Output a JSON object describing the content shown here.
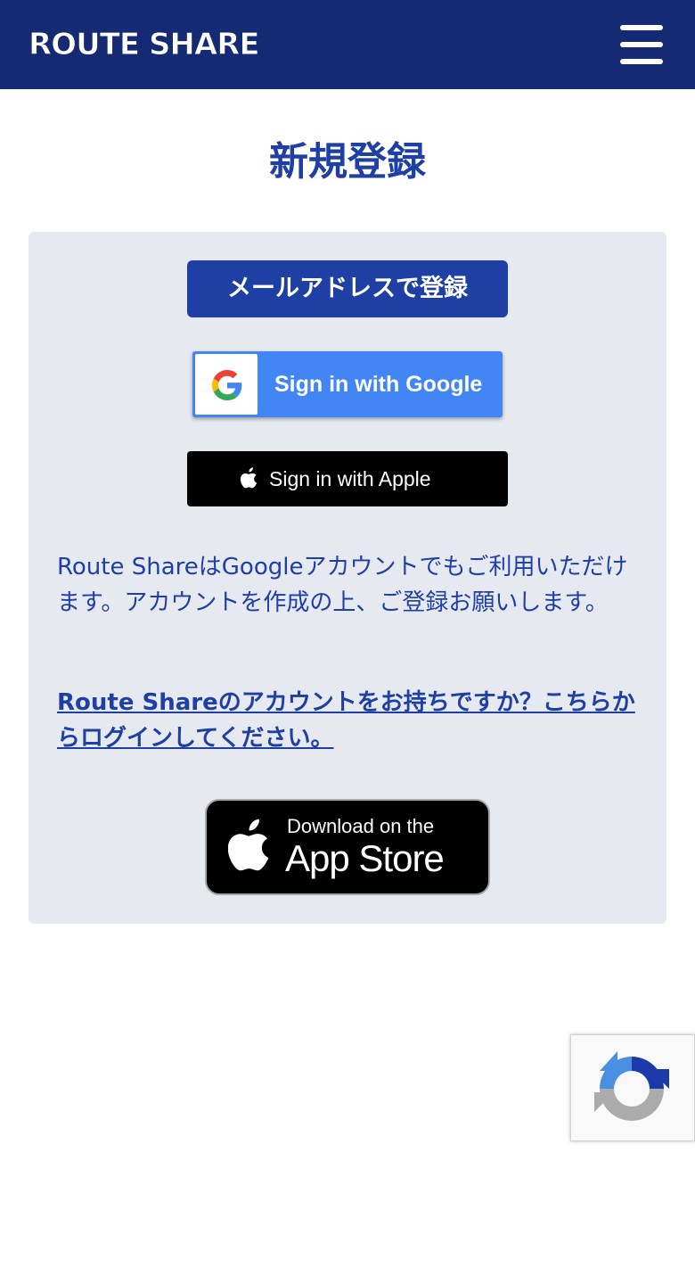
{
  "header": {
    "logo": "ROUTE SHARE",
    "menu_icon": "hamburger-menu-icon",
    "background": "#142a72"
  },
  "main": {
    "title": "新規登録",
    "email_button_label": "メールアドレスで登録",
    "google_button_label": "Sign in with Google",
    "apple_button_label": "Sign in with Apple",
    "info_text": "Route ShareはGoogleアカウントでもご利用いただけます。アカウントを作成の上、ご登録お願いします。",
    "login_link": "Route Shareのアカウントをお持ちですか？こちらからログインしてください。",
    "app_store_small": "Download on the",
    "app_store_big": "App Store"
  },
  "colors": {
    "accent": "#1e3fa3",
    "panel": "#e7e9f1",
    "google_blue": "#4285f4"
  },
  "widgets": {
    "recaptcha_icon": "recaptcha-icon"
  }
}
